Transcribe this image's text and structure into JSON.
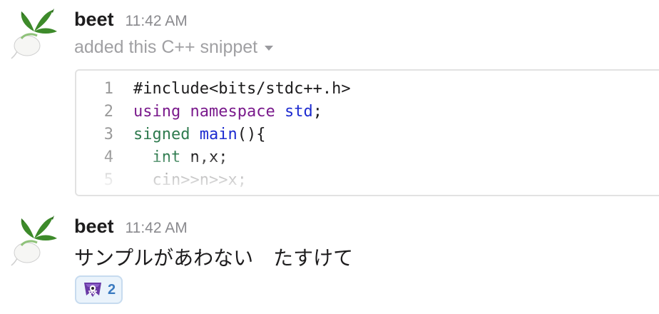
{
  "messages": [
    {
      "author": "beet",
      "time": "11:42 AM",
      "avatar_icon": "beet-avatar-icon",
      "snippet": {
        "meta": "added this C++ snippet",
        "lines": [
          {
            "num": "1",
            "segments": [
              {
                "text": "#include<bits/stdc++.h>",
                "style": "plain"
              }
            ]
          },
          {
            "num": "2",
            "segments": [
              {
                "text": "using",
                "style": "kw-purple"
              },
              {
                "text": " ",
                "style": "plain"
              },
              {
                "text": "namespace",
                "style": "kw-purple"
              },
              {
                "text": " ",
                "style": "plain"
              },
              {
                "text": "std",
                "style": "kw-blue"
              },
              {
                "text": ";",
                "style": "plain"
              }
            ]
          },
          {
            "num": "3",
            "segments": [
              {
                "text": "signed",
                "style": "kw-green"
              },
              {
                "text": " ",
                "style": "plain"
              },
              {
                "text": "main",
                "style": "kw-blue"
              },
              {
                "text": "(){",
                "style": "plain"
              }
            ]
          },
          {
            "num": "4",
            "segments": [
              {
                "text": "  ",
                "style": "plain"
              },
              {
                "text": "int",
                "style": "kw-green"
              },
              {
                "text": " n,x;",
                "style": "plain"
              }
            ]
          },
          {
            "num": "5",
            "segments": [
              {
                "text": "  cin>>n>>x;",
                "style": "plain"
              }
            ]
          }
        ]
      }
    },
    {
      "author": "beet",
      "time": "11:42 AM",
      "avatar_icon": "beet-avatar-icon",
      "text": "サンプルがあわない　たすけて",
      "reaction": {
        "emoji_icon": "purple-monster-emoji-icon",
        "count": "2"
      }
    }
  ],
  "colors": {
    "code_purple": "#7a1a8c",
    "code_blue": "#1d2bd0",
    "code_green": "#2f7b4f",
    "reaction_bg": "#eaf3fb",
    "reaction_border": "#c7dbef"
  }
}
